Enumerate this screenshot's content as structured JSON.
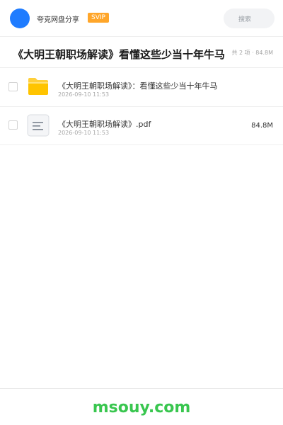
{
  "header": {
    "app_name": "夸克网盘分享",
    "badge": "SVIP",
    "search_placeholder": "搜索",
    "avatar_color": "#1f7cff",
    "badge_color": "#ffa62a"
  },
  "folder": {
    "title": "《大明王朝职场解读》看懂这些少当十年牛马",
    "summary": "共 2 项 · 84.8M"
  },
  "files": [
    {
      "icon": "folder-icon",
      "name": "《大明王朝职场解读》：看懂这些少当十年牛马",
      "date": "2026-09-10 11:53",
      "size": ""
    },
    {
      "icon": "document-icon",
      "name": "《大明王朝职场解读》.pdf",
      "date": "2026-09-10 11:53",
      "size": "84.8M"
    }
  ],
  "footer": {
    "watermark": "msouy.com",
    "watermark_color": "#39c64f"
  }
}
